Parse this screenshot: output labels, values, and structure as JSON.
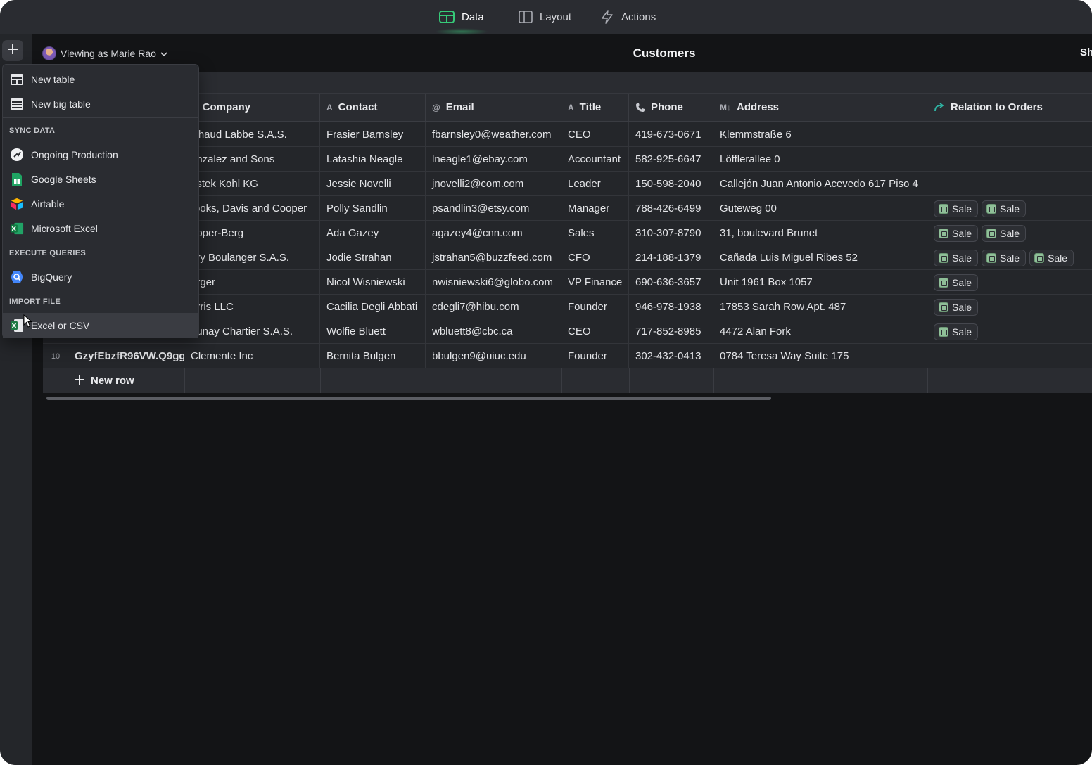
{
  "nav": {
    "tabs": [
      {
        "label": "Data",
        "icon": "table-grid-icon",
        "active": true
      },
      {
        "label": "Layout",
        "icon": "layout-icon",
        "active": false
      },
      {
        "label": "Actions",
        "icon": "lightning-icon",
        "active": false
      }
    ],
    "accent": "#36c978"
  },
  "header": {
    "viewing_as": "Viewing as Marie Rao",
    "title": "Customers",
    "share_partial": "Sh"
  },
  "grid": {
    "columns": [
      {
        "label": "Company",
        "icon": "text-icon"
      },
      {
        "label": "Contact",
        "icon": "text-icon"
      },
      {
        "label": "Email",
        "icon": "at-icon"
      },
      {
        "label": "Title",
        "icon": "text-icon"
      },
      {
        "label": "Phone",
        "icon": "phone-icon"
      },
      {
        "label": "Address",
        "icon": "markdown-icon"
      },
      {
        "label": "Relation to Orders",
        "icon": "relation-icon"
      }
    ],
    "rows": [
      {
        "num": "",
        "id": "",
        "company": "ichaud Labbe S.A.S.",
        "contact": "Frasier Barnsley",
        "email": "fbarnsley0@weather.com",
        "title": "CEO",
        "phone": "419-673-0671",
        "address": "Klemmstraße 6",
        "orders": []
      },
      {
        "num": "",
        "id": "",
        "company": "onzalez and Sons",
        "contact": "Latashia Neagle",
        "email": "lneagle1@ebay.com",
        "title": "Accountant",
        "phone": "582-925-6647",
        "address": "Löfflerallee 0",
        "orders": []
      },
      {
        "num": "",
        "id": "",
        "company": "ustek Kohl KG",
        "contact": "Jessie Novelli",
        "email": "jnovelli2@com.com",
        "title": "Leader",
        "phone": "150-598-2040",
        "address": "Callejón Juan Antonio Acevedo 617 Piso 4",
        "orders": []
      },
      {
        "num": "",
        "id": "",
        "company": "rooks, Davis and Cooper",
        "contact": "Polly Sandlin",
        "email": "psandlin3@etsy.com",
        "title": "Manager",
        "phone": "788-426-6499",
        "address": "Guteweg 00",
        "orders": [
          "Sale",
          "Sale"
        ]
      },
      {
        "num": "",
        "id": "",
        "company": "ooper-Berg",
        "contact": "Ada Gazey",
        "email": "agazey4@cnn.com",
        "title": "Sales",
        "phone": "310-307-8790",
        "address": "31, boulevard Brunet",
        "orders": [
          "Sale",
          "Sale"
        ]
      },
      {
        "num": "",
        "id": "",
        "company": "ary Boulanger S.A.S.",
        "contact": "Jodie Strahan",
        "email": "jstrahan5@buzzfeed.com",
        "title": "CFO",
        "phone": "214-188-1379",
        "address": "Cañada Luis Miguel Ribes 52",
        "orders": [
          "Sale",
          "Sale",
          "Sale"
        ]
      },
      {
        "num": "",
        "id": "",
        "company": "erger",
        "contact": "Nicol Wisniewski",
        "email": "nwisniewski6@globo.com",
        "title": "VP Finance",
        "phone": "690-636-3657",
        "address": "Unit 1961 Box 1057",
        "orders": [
          "Sale"
        ]
      },
      {
        "num": "",
        "id": "",
        "company": "orris LLC",
        "contact": "Cacilia Degli Abbati",
        "email": "cdegli7@hibu.com",
        "title": "Founder",
        "phone": "946-978-1938",
        "address": "17853 Sarah Row Apt. 487",
        "orders": [
          "Sale"
        ]
      },
      {
        "num": "",
        "id": "",
        "company": "aunay Chartier S.A.S.",
        "contact": "Wolfie Bluett",
        "email": "wbluett8@cbc.ca",
        "title": "CEO",
        "phone": "717-852-8985",
        "address": "4472 Alan Fork",
        "orders": [
          "Sale"
        ]
      },
      {
        "num": "10",
        "id": "GzyfEbzfR96VW.Q9gg",
        "company": "Clemente Inc",
        "contact": "Bernita Bulgen",
        "email": "bbulgen9@uiuc.edu",
        "title": "Founder",
        "phone": "302-432-0413",
        "address": "0784 Teresa Way Suite 175",
        "orders": []
      }
    ],
    "new_row_label": "New row"
  },
  "menu": {
    "items_top": [
      {
        "label": "New table",
        "icon": "new-table-icon"
      },
      {
        "label": "New big table",
        "icon": "new-big-table-icon"
      }
    ],
    "sections": [
      {
        "title": "SYNC DATA",
        "items": [
          {
            "label": "Ongoing Production",
            "icon": "ongoing-production-icon"
          },
          {
            "label": "Google Sheets",
            "icon": "google-sheets-icon"
          },
          {
            "label": "Airtable",
            "icon": "airtable-icon"
          },
          {
            "label": "Microsoft Excel",
            "icon": "microsoft-excel-icon"
          }
        ]
      },
      {
        "title": "EXECUTE QUERIES",
        "items": [
          {
            "label": "BigQuery",
            "icon": "bigquery-icon"
          }
        ]
      },
      {
        "title": "IMPORT FILE",
        "items": [
          {
            "label": "Excel or CSV",
            "icon": "excel-csv-icon"
          }
        ]
      }
    ]
  }
}
